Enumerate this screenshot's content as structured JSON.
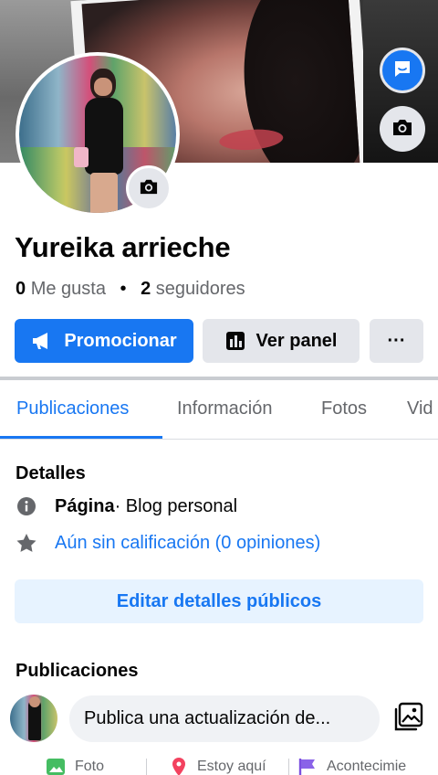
{
  "profile": {
    "name": "Yureika arrieche",
    "likes_count": "0",
    "likes_label": "Me gusta",
    "followers_count": "2",
    "followers_label": "seguidores"
  },
  "actions": {
    "promote_label": "Promocionar",
    "panel_label": "Ver panel",
    "more_label": "···"
  },
  "tabs": [
    {
      "label": "Publicaciones",
      "active": true
    },
    {
      "label": "Información",
      "active": false
    },
    {
      "label": "Fotos",
      "active": false
    },
    {
      "label": "Vid",
      "active": false
    }
  ],
  "details": {
    "title": "Detalles",
    "category_strong": "Página",
    "category_rest": " · Blog personal",
    "rating_text": "Aún sin calificación (0 opiniones)",
    "edit_button": "Editar detalles públicos"
  },
  "posts": {
    "title": "Publicaciones",
    "composer_placeholder": "Publica una actualización de..."
  },
  "bottom_actions": [
    {
      "label": "Foto",
      "icon": "photo-icon"
    },
    {
      "label": "Estoy aquí",
      "icon": "location-pin-icon"
    },
    {
      "label": "Acontecimie",
      "icon": "flag-icon"
    }
  ],
  "colors": {
    "accent": "#1877f2",
    "button_gray": "#e4e6eb",
    "edit_button_bg": "#e7f3ff",
    "secondary_text": "#65676b"
  }
}
